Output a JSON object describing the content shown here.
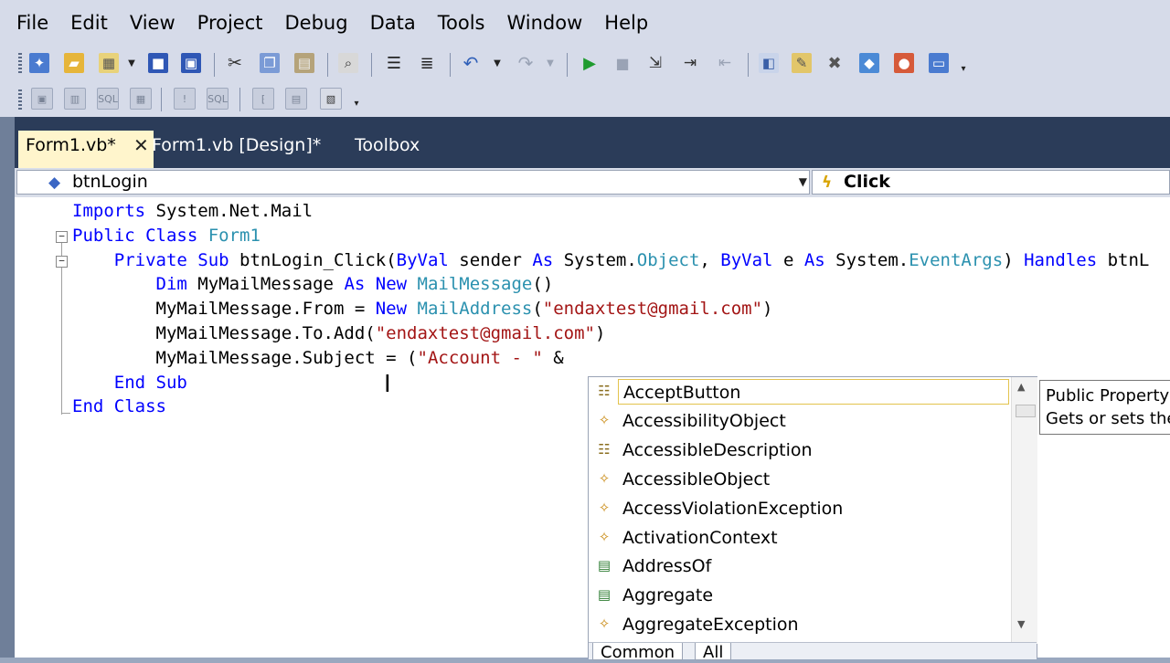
{
  "menu": [
    "File",
    "Edit",
    "View",
    "Project",
    "Debug",
    "Data",
    "Tools",
    "Window",
    "Help"
  ],
  "tabs": [
    {
      "label": "Form1.vb*",
      "active": true
    },
    {
      "label": "Form1.vb [Design]*",
      "active": false
    },
    {
      "label": "Toolbox",
      "active": false
    }
  ],
  "navbar": {
    "object": "btnLogin",
    "event": "Click"
  },
  "code_lines": [
    [
      {
        "t": "Imports ",
        "c": "kw"
      },
      {
        "t": "System.Net.Mail",
        "c": ""
      }
    ],
    [
      {
        "t": "Public ",
        "c": "kw"
      },
      {
        "t": "Class ",
        "c": "kw"
      },
      {
        "t": "Form1",
        "c": "ty"
      }
    ],
    [
      {
        "t": "    Private ",
        "c": "kw"
      },
      {
        "t": "Sub ",
        "c": "kw"
      },
      {
        "t": "btnLogin_Click(",
        "c": ""
      },
      {
        "t": "ByVal ",
        "c": "kw"
      },
      {
        "t": "sender ",
        "c": ""
      },
      {
        "t": "As ",
        "c": "kw"
      },
      {
        "t": "System.",
        "c": ""
      },
      {
        "t": "Object",
        "c": "ty"
      },
      {
        "t": ", ",
        "c": ""
      },
      {
        "t": "ByVal ",
        "c": "kw"
      },
      {
        "t": "e ",
        "c": ""
      },
      {
        "t": "As ",
        "c": "kw"
      },
      {
        "t": "System.",
        "c": ""
      },
      {
        "t": "EventArgs",
        "c": "ty"
      },
      {
        "t": ") ",
        "c": ""
      },
      {
        "t": "Handles ",
        "c": "kw"
      },
      {
        "t": "btnL",
        "c": ""
      }
    ],
    [
      {
        "t": "        Dim ",
        "c": "kw"
      },
      {
        "t": "MyMailMessage ",
        "c": ""
      },
      {
        "t": "As ",
        "c": "kw"
      },
      {
        "t": "New ",
        "c": "kw"
      },
      {
        "t": "MailMessage",
        "c": "ty"
      },
      {
        "t": "()",
        "c": ""
      }
    ],
    [
      {
        "t": "        MyMailMessage.From = ",
        "c": ""
      },
      {
        "t": "New ",
        "c": "kw"
      },
      {
        "t": "MailAddress",
        "c": "ty"
      },
      {
        "t": "(",
        "c": ""
      },
      {
        "t": "\"endaxtest@gmail.com\"",
        "c": "st"
      },
      {
        "t": ")",
        "c": ""
      }
    ],
    [
      {
        "t": "        MyMailMessage.To.Add(",
        "c": ""
      },
      {
        "t": "\"endaxtest@gmail.com\"",
        "c": "st"
      },
      {
        "t": ")",
        "c": ""
      }
    ],
    [
      {
        "t": "        MyMailMessage.Subject = (",
        "c": ""
      },
      {
        "t": "\"Account - \"",
        "c": "st"
      },
      {
        "t": " &",
        "c": ""
      }
    ],
    [
      {
        "t": "    End ",
        "c": "kw"
      },
      {
        "t": "Sub",
        "c": "kw"
      }
    ],
    [
      {
        "t": "End ",
        "c": "kw"
      },
      {
        "t": "Class",
        "c": "kw"
      }
    ]
  ],
  "intellisense": {
    "items": [
      {
        "label": "AcceptButton",
        "icon": "property-icon",
        "selected": true
      },
      {
        "label": "AccessibilityObject",
        "icon": "class-icon",
        "selected": false
      },
      {
        "label": "AccessibleDescription",
        "icon": "property-icon",
        "selected": false
      },
      {
        "label": "AccessibleObject",
        "icon": "class-icon",
        "selected": false
      },
      {
        "label": "AccessViolationException",
        "icon": "class-icon",
        "selected": false
      },
      {
        "label": "ActivationContext",
        "icon": "class-icon",
        "selected": false
      },
      {
        "label": "AddressOf",
        "icon": "keyword-icon",
        "selected": false
      },
      {
        "label": "Aggregate",
        "icon": "keyword-icon",
        "selected": false
      },
      {
        "label": "AggregateException",
        "icon": "class-icon",
        "selected": false
      }
    ],
    "tabs": [
      "Common",
      "All"
    ]
  },
  "tooltip": {
    "line1": "Public Property",
    "line2": "Gets or sets the"
  },
  "colors": {
    "keyword": "#0000ff",
    "type": "#2b91af",
    "string": "#a31515",
    "tab_active": "#fff5cc",
    "tab_strip": "#2b3c59"
  }
}
